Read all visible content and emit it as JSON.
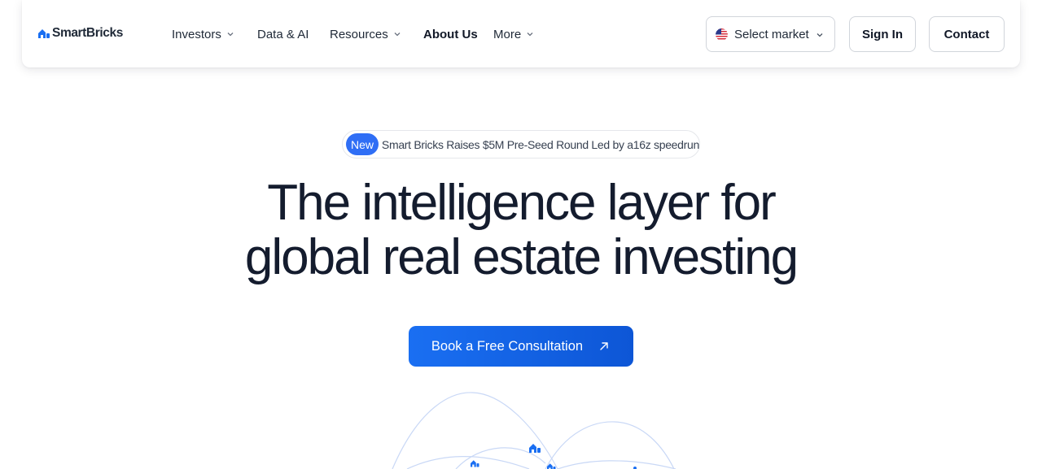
{
  "brand": {
    "name": "SmartBricks",
    "accent": "#1a6ff2"
  },
  "nav": {
    "items": [
      {
        "label": "Investors",
        "has_dropdown": true
      },
      {
        "label": "Data & AI",
        "has_dropdown": false
      },
      {
        "label": "Resources",
        "has_dropdown": true
      },
      {
        "label": "About Us",
        "has_dropdown": false
      },
      {
        "label": "More",
        "has_dropdown": true
      }
    ],
    "market_select": {
      "label": "Select market",
      "flag_icon": "us-flag-icon"
    },
    "sign_in": "Sign In",
    "contact": "Contact"
  },
  "announcement": {
    "badge": "New",
    "text": "Smart Bricks Raises $5M Pre-Seed Round Led by a16z speedrun"
  },
  "hero": {
    "title_line1": "The intelligence layer for",
    "title_line2": "global real estate investing",
    "cta_label": "Book a Free Consultation",
    "cta_icon": "arrow-up-right-icon"
  }
}
